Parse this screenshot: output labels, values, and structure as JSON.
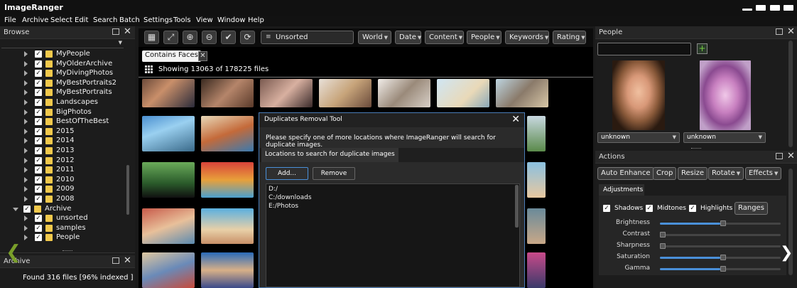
{
  "app": {
    "title": "ImageRanger"
  },
  "menu": [
    "File",
    "Archive",
    "Select",
    "Edit",
    "Search",
    "Batch",
    "Settings",
    "Tools",
    "View",
    "Window",
    "Help"
  ],
  "browse": {
    "title": "Browse",
    "items": [
      {
        "label": "MyPeople",
        "expanded": false,
        "checked": true
      },
      {
        "label": "MyOlderArchive",
        "expanded": false,
        "checked": true
      },
      {
        "label": "MyDivingPhotos",
        "expanded": false,
        "checked": true
      },
      {
        "label": "MyBestPortraits2",
        "expanded": false,
        "checked": true
      },
      {
        "label": "MyBestPortraits",
        "expanded": false,
        "checked": true
      },
      {
        "label": "Landscapes",
        "expanded": false,
        "checked": true
      },
      {
        "label": "BigPhotos",
        "expanded": false,
        "checked": true
      },
      {
        "label": "BestOfTheBest",
        "expanded": false,
        "checked": true
      },
      {
        "label": "2015",
        "expanded": false,
        "checked": true
      },
      {
        "label": "2014",
        "expanded": false,
        "checked": true
      },
      {
        "label": "2013",
        "expanded": false,
        "checked": true
      },
      {
        "label": "2012",
        "expanded": false,
        "checked": true
      },
      {
        "label": "2011",
        "expanded": false,
        "checked": true
      },
      {
        "label": "2010",
        "expanded": false,
        "checked": true
      },
      {
        "label": "2009",
        "expanded": false,
        "checked": true
      },
      {
        "label": "2008",
        "expanded": false,
        "checked": true
      },
      {
        "label": "Archive",
        "expanded": true,
        "checked": true
      },
      {
        "label": "unsorted",
        "expanded": false,
        "checked": true
      },
      {
        "label": "samples",
        "expanded": false,
        "checked": true
      },
      {
        "label": "People",
        "expanded": false,
        "checked": true
      }
    ]
  },
  "archive": {
    "title": "Archive",
    "status": "Found 316 files [96% indexed ]"
  },
  "toolbar": {
    "sort_value": "Unsorted",
    "filters": [
      "World",
      "Date",
      "Content",
      "People",
      "Keywords",
      "Rating"
    ]
  },
  "filter": {
    "active_tag": "Contains Faces",
    "showing": "Showing 13063 of 178225 files"
  },
  "dialog": {
    "title": "Duplicates Removal Tool",
    "message": "Please specify one of more locations where ImageRanger will search for duplicate images.",
    "tab": "Locations to search for duplicate images",
    "add_label": "Add...",
    "remove_label": "Remove",
    "locations": [
      "D:/",
      "C:/downloads",
      "E:/Photos"
    ]
  },
  "people": {
    "title": "People",
    "search_placeholder": "",
    "faces": [
      {
        "name": "unknown"
      },
      {
        "name": "unknown"
      }
    ]
  },
  "actions": {
    "title": "Actions",
    "buttons": [
      "Auto Enhance",
      "Crop",
      "Resize",
      "Rotate",
      "Effects"
    ],
    "adjustments_tab": "Adjustments",
    "checks": [
      {
        "label": "Shadows",
        "checked": true
      },
      {
        "label": "Midtones",
        "checked": true
      },
      {
        "label": "Highlights",
        "checked": true
      }
    ],
    "ranges_label": "Ranges",
    "sliders": [
      {
        "label": "Brightness",
        "value": 0.5
      },
      {
        "label": "Contrast",
        "value": 0.0
      },
      {
        "label": "Sharpness",
        "value": 0.0
      },
      {
        "label": "Saturation",
        "value": 0.5
      },
      {
        "label": "Gamma",
        "value": 0.5
      }
    ]
  },
  "colors": {
    "accent": "#4a90d9",
    "folder": "#f2c94c",
    "nav_arrow": "#7a9f2a"
  }
}
